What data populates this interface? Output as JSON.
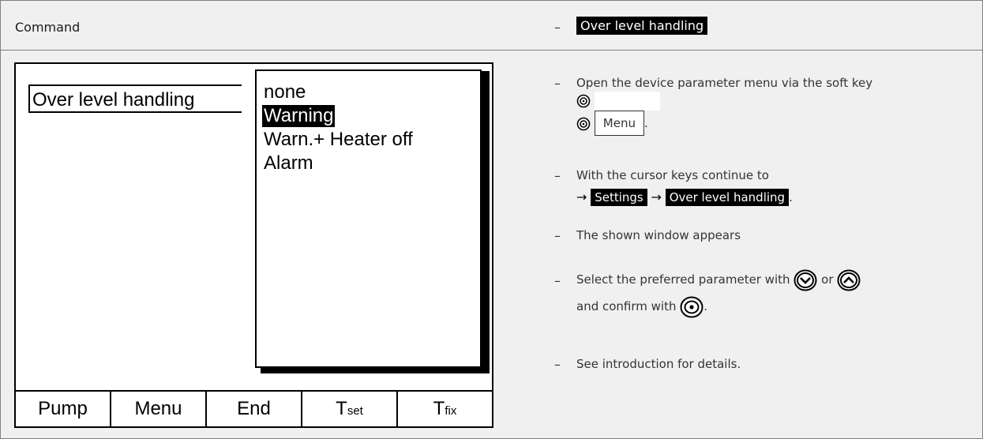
{
  "header": {
    "command_label": "Command",
    "dash": "–",
    "title_highlight": "Over level handling"
  },
  "screen": {
    "param_label": "Over level handling",
    "options": [
      "none",
      "Warning",
      "Warn.+ Heater off",
      "Alarm"
    ],
    "selected_index": 1,
    "softkeys": [
      {
        "main": "Pump",
        "sub": ""
      },
      {
        "main": "Menu",
        "sub": ""
      },
      {
        "main": "End",
        "sub": ""
      },
      {
        "main": "T",
        "sub": "set"
      },
      {
        "main": "T",
        "sub": "fix"
      }
    ]
  },
  "instructions": {
    "step1": "Open the device parameter menu via the soft key",
    "menu_key": "Menu",
    "step2_prefix": "With the cursor keys continue to",
    "arrow": "→",
    "path1": "Settings",
    "path2": "Over level handling",
    "step3": "The shown window appears",
    "step4a": "Select the preferred parameter with",
    "step4_or": "or",
    "step4b": "and confirm with",
    "step5": "See introduction for details.",
    "period": "."
  }
}
